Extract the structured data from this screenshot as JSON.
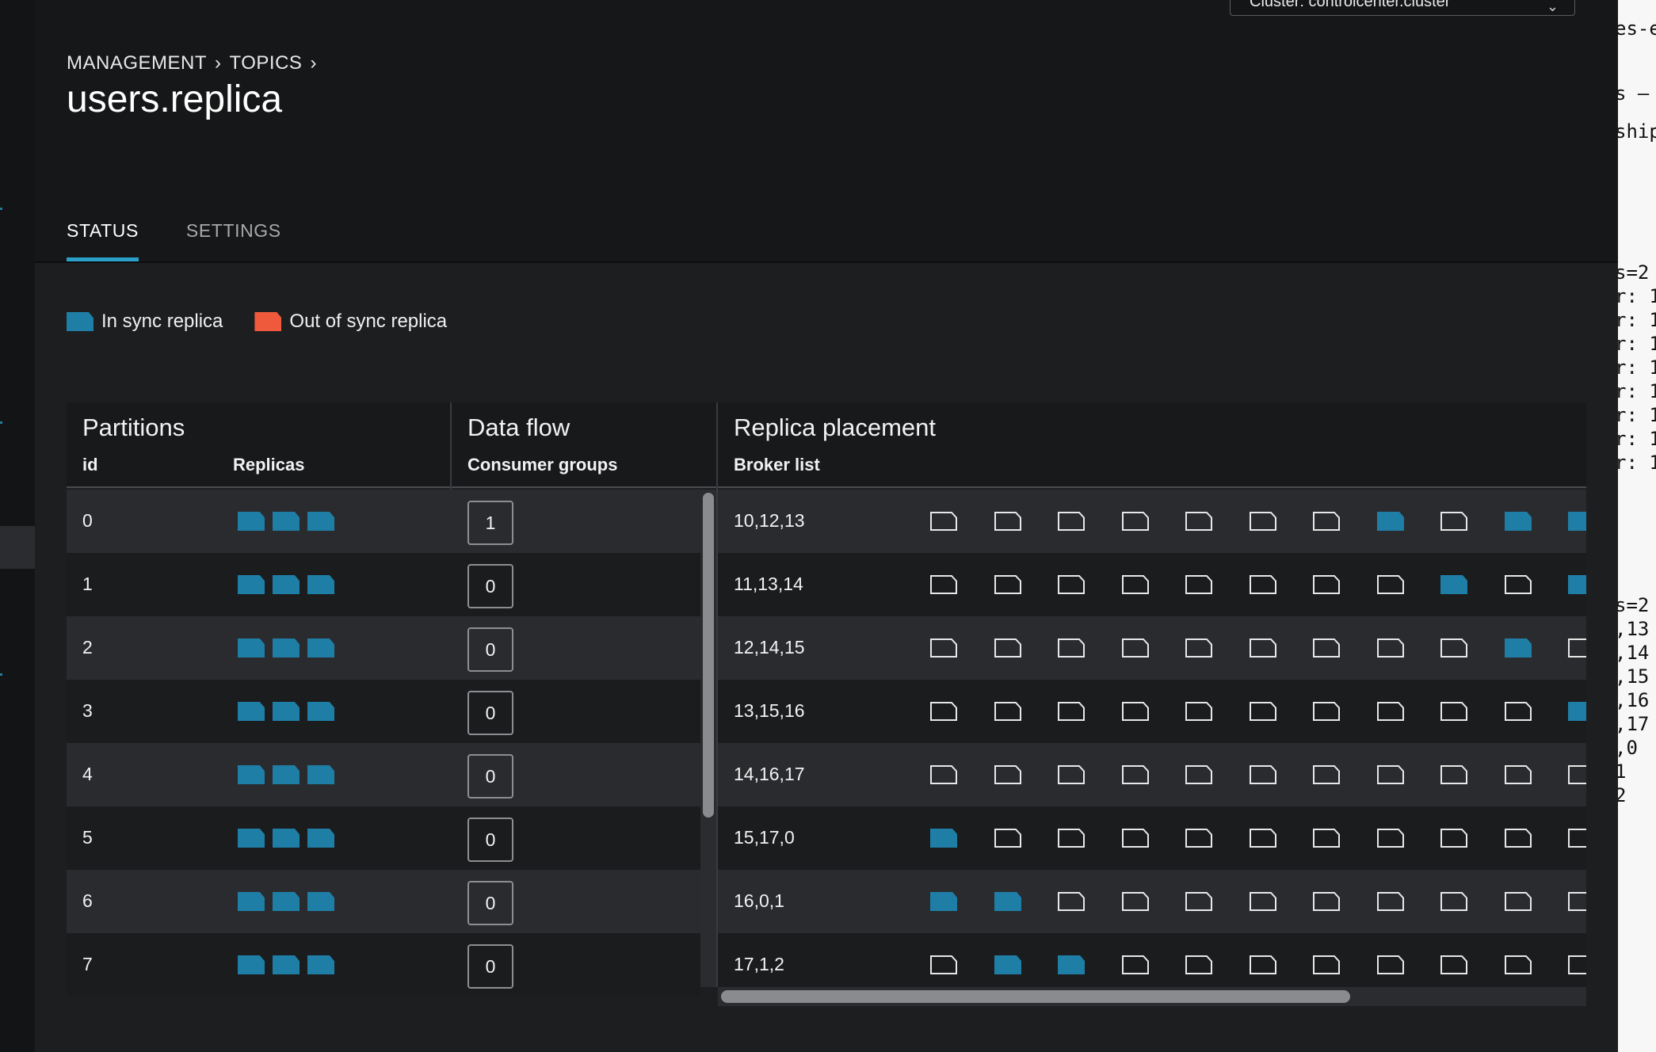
{
  "cluster_select": {
    "label": "Cluster: controlcenter.cluster"
  },
  "breadcrumb": {
    "items": [
      "MANAGEMENT",
      "TOPICS"
    ]
  },
  "page": {
    "title": "users.replica"
  },
  "tabs": [
    {
      "label": "STATUS",
      "active": true
    },
    {
      "label": "SETTINGS",
      "active": false
    }
  ],
  "legend": [
    {
      "label": "In sync replica",
      "color": "#1f7ea6"
    },
    {
      "label": "Out of sync replica",
      "color": "#f05a3c"
    }
  ],
  "table": {
    "groups": {
      "partitions": "Partitions",
      "data_flow": "Data flow",
      "replica_placement": "Replica placement"
    },
    "columns": {
      "id": "id",
      "replicas": "Replicas",
      "consumer_groups": "Consumer groups",
      "broker_list": "Broker list"
    },
    "rows": [
      {
        "id": "0",
        "consumer_groups": "1",
        "broker_list": "10,12,13",
        "brokers": [
          0,
          0,
          0,
          0,
          0,
          0,
          0,
          1,
          0,
          1,
          1
        ]
      },
      {
        "id": "1",
        "consumer_groups": "0",
        "broker_list": "11,13,14",
        "brokers": [
          0,
          0,
          0,
          0,
          0,
          0,
          0,
          0,
          1,
          0,
          1
        ]
      },
      {
        "id": "2",
        "consumer_groups": "0",
        "broker_list": "12,14,15",
        "brokers": [
          0,
          0,
          0,
          0,
          0,
          0,
          0,
          0,
          0,
          1,
          0
        ]
      },
      {
        "id": "3",
        "consumer_groups": "0",
        "broker_list": "13,15,16",
        "brokers": [
          0,
          0,
          0,
          0,
          0,
          0,
          0,
          0,
          0,
          0,
          1
        ]
      },
      {
        "id": "4",
        "consumer_groups": "0",
        "broker_list": "14,16,17",
        "brokers": [
          0,
          0,
          0,
          0,
          0,
          0,
          0,
          0,
          0,
          0,
          0
        ]
      },
      {
        "id": "5",
        "consumer_groups": "0",
        "broker_list": "15,17,0",
        "brokers": [
          1,
          0,
          0,
          0,
          0,
          0,
          0,
          0,
          0,
          0,
          0
        ]
      },
      {
        "id": "6",
        "consumer_groups": "0",
        "broker_list": "16,0,1",
        "brokers": [
          1,
          1,
          0,
          0,
          0,
          0,
          0,
          0,
          0,
          0,
          0
        ]
      },
      {
        "id": "7",
        "consumer_groups": "0",
        "broker_list": "17,1,2",
        "brokers": [
          0,
          1,
          1,
          0,
          0,
          0,
          0,
          0,
          0,
          0,
          0
        ]
      }
    ]
  },
  "terminal": {
    "lines": [
      "es-e",
      "s — (",
      "ship",
      "s=2",
      "r: 1",
      "r: 1",
      "r: 1",
      "r: 1",
      "r: 1",
      "r: 1",
      "r: 1",
      "r: 1",
      "s=2",
      ",13",
      ",14",
      ",15",
      ",16",
      ",17",
      ",0",
      "1",
      "2"
    ]
  }
}
